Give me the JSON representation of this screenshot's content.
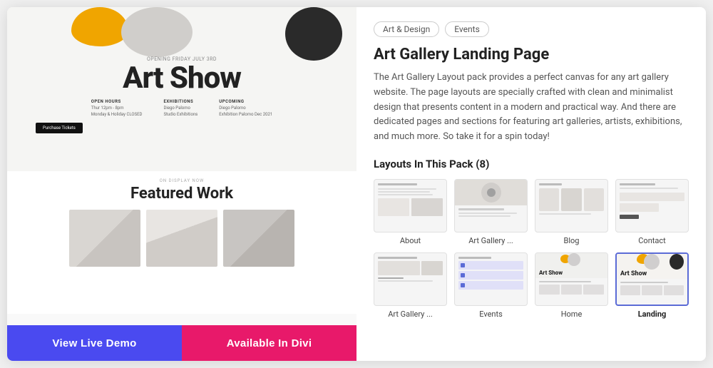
{
  "left": {
    "preview": {
      "opening_text": "OPENING FRIDAY JULY 3RD",
      "title": "Art Show",
      "info": [
        {
          "label": "OPEN HOURS",
          "values": [
            "Thur 12pm - 8pm",
            "Monday & Holiday CLOSED"
          ]
        },
        {
          "label": "EXHIBITIONS",
          "values": [
            "Diego Palomo",
            "Studio Exhibitions"
          ]
        },
        {
          "label": "UPCOMING",
          "values": [
            "Diego Palomo",
            "Exhibition Palomo Dec 2021"
          ]
        }
      ],
      "purchase_btn": "Purchase Tickets",
      "on_display": "ON DISPLAY NOW",
      "featured_title": "Featured Work"
    },
    "buttons": {
      "demo": "View Live Demo",
      "divi": "Available In Divi"
    }
  },
  "right": {
    "tags": [
      "Art & Design",
      "Events"
    ],
    "title": "Art Gallery Landing Page",
    "description": "The Art Gallery Layout pack provides a perfect canvas for any art gallery website. The page layouts are specially crafted with clean and minimalist design that presents content in a modern and practical way. And there are dedicated pages and sections for featuring art galleries, artists, exhibitions, and much more. So take it for a spin today!",
    "layouts_heading": "Layouts In This Pack (8)",
    "layouts": [
      {
        "label": "About",
        "type": "about"
      },
      {
        "label": "Art Gallery ...",
        "type": "artgallery"
      },
      {
        "label": "Blog",
        "type": "blog"
      },
      {
        "label": "Contact",
        "type": "contact"
      },
      {
        "label": "Art Gallery ...",
        "type": "artgallery2"
      },
      {
        "label": "Events",
        "type": "events"
      },
      {
        "label": "Home",
        "type": "home"
      },
      {
        "label": "Landing",
        "type": "landing",
        "active": true
      }
    ]
  }
}
